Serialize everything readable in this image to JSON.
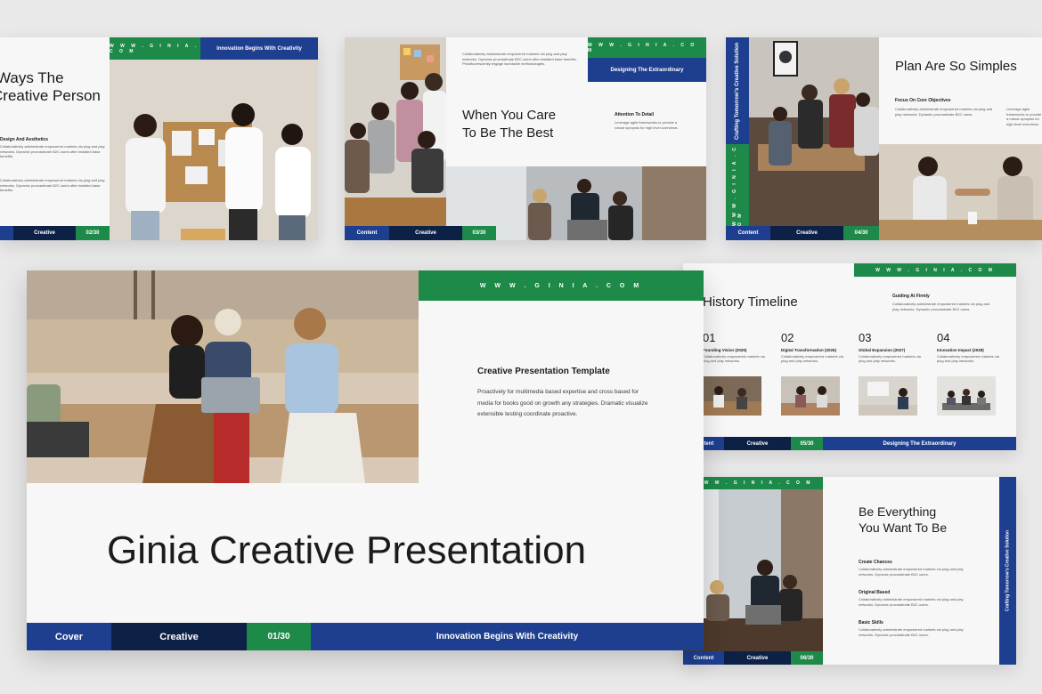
{
  "slide_tl": {
    "title_line1": "Ways The",
    "title_line2": "Creative Person",
    "url": "W W W . G I N I A . C O M",
    "tagline": "Innovation Begins With Creativity",
    "section_head": "Design And Aesthetics",
    "para1": "Collaboratively administrate empowered markets via plug and play networks. Dynamic procrastinate B2C users after installed base benefits.",
    "para2": "Collaboratively administrate empowered markets via plug and play networks. Dynamic procrastinate B2C users after installed base benefits.",
    "footer_label": "Creative",
    "page": "02/30"
  },
  "slide_tc": {
    "url": "W W W . G I N I A . C O M",
    "tagline": "Designing The Extraordinary",
    "top_para": "Collaboratively administrate empowered markets via plug and play networks. Dynamic procrastinate B2C users after installed base benefits. Phosfluorescently engage worldwide methodologies.",
    "title_line1": "When You Care",
    "title_line2": "To Be The Best",
    "side_head": "Attention To Detail",
    "side_para": "Leverage agile frameworks to provide a robust synopsis for high level overviews.",
    "footer_content": "Content",
    "footer_creative": "Creative",
    "page": "03/30"
  },
  "slide_tr": {
    "vertical_text": "Crafting Tomorrow's Creative Solution",
    "vertical_url": "W W W . G I N I A . C O M",
    "title": "Plan Are So Simples",
    "head": "Focus On Core Objectives",
    "para1": "Collaboratively administrate empowered markets via plug and play networks. Dynamic procrastinate B2C users.",
    "para2": "Leverage agile frameworks to provide a robust synopsis for high level overviews.",
    "footer_content": "Content",
    "footer_creative": "Creative",
    "page": "04/30"
  },
  "slide_main": {
    "url": "W W W . G I N I A . C O M",
    "subtitle": "Creative Presentation Template",
    "body": "Proactively for multimedia based expertise and cross based for media for books good on growth any strategies. Dramatic visualize extensible testing coordinate proactive.",
    "title": "Ginia Creative Presentation",
    "footer_cover": "Cover",
    "footer_creative": "Creative",
    "page": "01/30",
    "footer_tagline": "Innovation Begins With Creativity"
  },
  "slide_mr": {
    "url": "W W W . G I N I A . C O M",
    "title": "History Timeline",
    "side_head": "Guiding At Firmly",
    "side_para": "Collaboratively administrate empowered markets via plug and play networks. Dynamic procrastinate B2C users.",
    "items": [
      {
        "num": "01",
        "label": "Founding Vision (2025)",
        "text": "Collaboratively empowered markets via plug and play networks."
      },
      {
        "num": "02",
        "label": "Digital Transformation (2026)",
        "text": "Collaboratively empowered markets via plug and play networks."
      },
      {
        "num": "03",
        "label": "Global Expansion (2027)",
        "text": "Collaboratively empowered markets via plug and play networks."
      },
      {
        "num": "04",
        "label": "Innovation Impact (2028)",
        "text": "Collaboratively empowered markets via plug and play networks."
      }
    ],
    "footer_content": "Content",
    "footer_creative": "Creative",
    "page": "05/30",
    "footer_tagline": "Designing The Extraordinary"
  },
  "slide_br": {
    "url": "W W W . G I N I A . C O M",
    "title_line1": "Be Everything",
    "title_line2": "You Want To Be",
    "vertical_text": "Crafting Tomorrow's Creative Solution",
    "blocks": [
      {
        "head": "Create Chances",
        "text": "Collaboratively administrate empowered markets via plug and play networks. Dynamic procrastinate B2C users."
      },
      {
        "head": "Original Based",
        "text": "Collaboratively administrate empowered markets via plug and play networks. Dynamic procrastinate B2C users."
      },
      {
        "head": "Basic Skills",
        "text": "Collaboratively administrate empowered markets via plug and play networks. Dynamic procrastinate B2C users."
      }
    ],
    "footer_content": "Content",
    "footer_creative": "Creative",
    "page": "06/30"
  },
  "colors": {
    "green": "#1d8a4a",
    "blue": "#1e3f8f",
    "navy": "#0d2147",
    "background": "#e9e9e9",
    "slide": "#f7f7f7"
  }
}
